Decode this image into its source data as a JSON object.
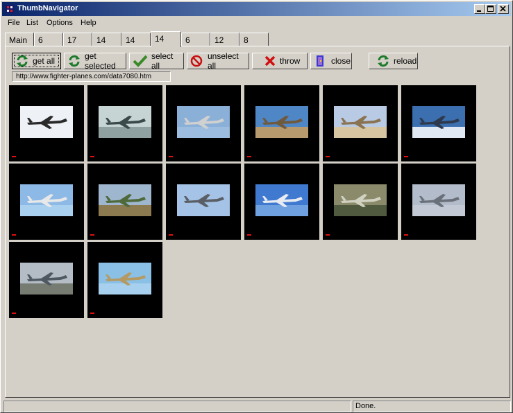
{
  "window": {
    "title": "ThumbNavigator"
  },
  "menu": [
    "File",
    "List",
    "Options",
    "Help"
  ],
  "tabs": [
    "Main",
    "6",
    "17",
    "14",
    "14",
    "14",
    "6",
    "12",
    "8"
  ],
  "active_tab": 5,
  "toolbar": {
    "get_all": "get all",
    "get_selected": "get selected",
    "select_all": "select all",
    "unselect_all": "unselect all",
    "throw": "throw",
    "close": "close",
    "reload": "reload"
  },
  "url": "http://www.fighter-planes.com/data7080.htm",
  "thumbnails": [
    {
      "sky": "#eef1f6",
      "ground": "#eef1f6",
      "plane": "#2a2a2a"
    },
    {
      "sky": "#c7d4d4",
      "ground": "#8fa1a0",
      "plane": "#3a4a4a"
    },
    {
      "sky": "#8bb0d8",
      "ground": "#9cbde0",
      "plane": "#d0d0d0"
    },
    {
      "sky": "#4f86c6",
      "ground": "#b79a6e",
      "plane": "#6f5a3e"
    },
    {
      "sky": "#b9cbe4",
      "ground": "#d7c4a0",
      "plane": "#8a7350"
    },
    {
      "sky": "#3b6fb0",
      "ground": "#e0e8f4",
      "plane": "#2e3a4c"
    },
    {
      "sky": "#8db9e6",
      "ground": "#aad0f0",
      "plane": "#e8e8e8"
    },
    {
      "sky": "#9fb6cf",
      "ground": "#8c7a50",
      "plane": "#4e6a3a"
    },
    {
      "sky": "#a4c3e6",
      "ground": "#a4c3e6",
      "plane": "#5a5f66"
    },
    {
      "sky": "#3f7ad0",
      "ground": "#6fa0e0",
      "plane": "#e8ecf2"
    },
    {
      "sky": "#8b8b6c",
      "ground": "#4f5a3e",
      "plane": "#d2d2c2"
    },
    {
      "sky": "#b3bccb",
      "ground": "#c3cad6",
      "plane": "#6a707a"
    },
    {
      "sky": "#b4bcc6",
      "ground": "#767c72",
      "plane": "#4e5860"
    },
    {
      "sky": "#8ac0e6",
      "ground": "#a6d0ee",
      "plane": "#b49a62"
    }
  ],
  "status": {
    "left": "",
    "right": "Done."
  }
}
